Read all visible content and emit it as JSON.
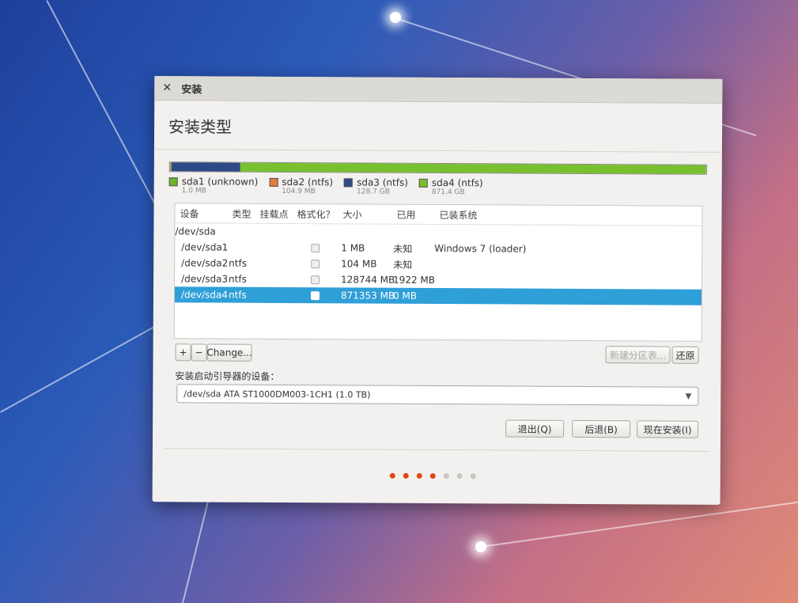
{
  "window": {
    "title": "安装",
    "close_icon": "close-icon"
  },
  "page": {
    "heading": "安装类型"
  },
  "partition_bar": {
    "segments": [
      {
        "name": "sda1",
        "color": "#6ab32a",
        "fraction": 1e-05
      },
      {
        "name": "sda2",
        "color": "#e67a3a",
        "fraction": 0.0001
      },
      {
        "name": "sda3",
        "color": "#2d4a86",
        "fraction": 0.1287
      },
      {
        "name": "sda4",
        "color": "#79c02e",
        "fraction": 0.8712
      }
    ]
  },
  "legend": [
    {
      "label": "sda1 (unknown)",
      "size": "1.0 MB",
      "color": "#6ab32a"
    },
    {
      "label": "sda2 (ntfs)",
      "size": "104.9 MB",
      "color": "#e67a3a"
    },
    {
      "label": "sda3 (ntfs)",
      "size": "128.7 GB",
      "color": "#2d4a86"
    },
    {
      "label": "sda4 (ntfs)",
      "size": "871.4 GB",
      "color": "#79c02e"
    }
  ],
  "table": {
    "headers": [
      "设备",
      "类型",
      "挂载点",
      "格式化？",
      "大小",
      "已用",
      "已装系统"
    ],
    "group": "/dev/sda",
    "rows": [
      {
        "device": "/dev/sda1",
        "type": "",
        "size": "1 MB",
        "used": "未知",
        "os": "Windows 7 (loader)",
        "selected": false
      },
      {
        "device": "/dev/sda2",
        "type": "ntfs",
        "size": "104 MB",
        "used": "未知",
        "os": "",
        "selected": false
      },
      {
        "device": "/dev/sda3",
        "type": "ntfs",
        "size": "128744 MB",
        "used": "1922 MB",
        "os": "",
        "selected": false
      },
      {
        "device": "/dev/sda4",
        "type": "ntfs",
        "size": "871353 MB",
        "used": "0 MB",
        "os": "",
        "selected": true
      }
    ]
  },
  "toolbar": {
    "add": "+",
    "remove": "−",
    "change": "Change...",
    "new_table": "新建分区表...",
    "revert": "还原"
  },
  "bootloader": {
    "label": "安装启动引导器的设备：",
    "value": "/dev/sda    ATA ST1000DM003-1CH1 (1.0 TB)"
  },
  "actions": {
    "quit": "退出(Q)",
    "back": "后退(B)",
    "install": "现在安装(I)"
  },
  "progress": {
    "total_steps": 7,
    "current_step": 4,
    "active_color": "#dd4814",
    "inactive_color": "#c8c6c2"
  }
}
